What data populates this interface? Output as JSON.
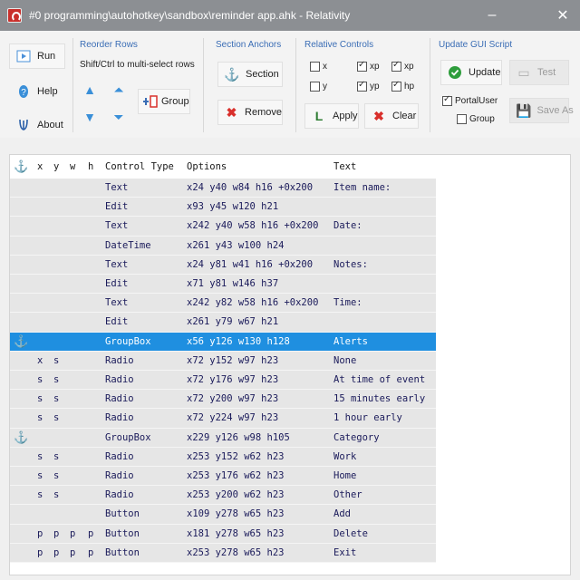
{
  "window": {
    "title": "#0 programming\\autohotkey\\sandbox\\reminder app.ahk - Relativity",
    "minimize": "–",
    "maximize": "□",
    "close": "✕"
  },
  "toolbar": {
    "run_label": "Run",
    "help_label": "Help",
    "about_label": "About",
    "reorder_rows": {
      "title": "Reorder Rows",
      "hint": "Shift/Ctrl to multi-select rows",
      "group_label": "Group"
    },
    "section_anchors": {
      "title": "Section Anchors",
      "section_label": "Section",
      "remove_label": "Remove"
    },
    "relative_controls": {
      "title": "Relative Controls",
      "checkboxes": [
        {
          "label": "x",
          "checked": false
        },
        {
          "label": "xp",
          "checked": true
        },
        {
          "label": "xp",
          "checked": true
        },
        {
          "label": "y",
          "checked": false
        },
        {
          "label": "yp",
          "checked": true
        },
        {
          "label": "hp",
          "checked": true
        }
      ],
      "apply_label": "Apply",
      "clear_label": "Clear"
    },
    "update_script": {
      "title": "Update GUI Script",
      "update_label": "Update",
      "test_label": "Test",
      "save_as_label": "Save As",
      "portal_label": "PortalUser",
      "group_label": "Group"
    }
  },
  "grid": {
    "headers": [
      "x",
      "y",
      "w",
      "h",
      "Control Type",
      "Options",
      "Text"
    ],
    "rows": [
      {
        "anchor": false,
        "x": "",
        "y": "",
        "w": "",
        "h": "",
        "type": "Text",
        "options": "x24 y40 w84 h16 +0x200",
        "text": "Item name:"
      },
      {
        "anchor": false,
        "x": "",
        "y": "",
        "w": "",
        "h": "",
        "type": "Edit",
        "options": "x93 y45 w120 h21",
        "text": ""
      },
      {
        "anchor": false,
        "x": "",
        "y": "",
        "w": "",
        "h": "",
        "type": "Text",
        "options": "x242 y40 w58 h16 +0x200",
        "text": "Date:"
      },
      {
        "anchor": false,
        "x": "",
        "y": "",
        "w": "",
        "h": "",
        "type": "DateTime",
        "options": "x261 y43 w100 h24",
        "text": ""
      },
      {
        "anchor": false,
        "x": "",
        "y": "",
        "w": "",
        "h": "",
        "type": "Text",
        "options": "x24 y81 w41 h16 +0x200",
        "text": "Notes:"
      },
      {
        "anchor": false,
        "x": "",
        "y": "",
        "w": "",
        "h": "",
        "type": "Edit",
        "options": "x71 y81 w146 h37",
        "text": ""
      },
      {
        "anchor": false,
        "x": "",
        "y": "",
        "w": "",
        "h": "",
        "type": "Text",
        "options": "x242 y82 w58 h16 +0x200",
        "text": "Time:"
      },
      {
        "anchor": false,
        "x": "",
        "y": "",
        "w": "",
        "h": "",
        "type": "Edit",
        "options": "x261 y79 w67 h21",
        "text": ""
      },
      {
        "anchor": true,
        "x": "",
        "y": "",
        "w": "",
        "h": "",
        "type": "GroupBox",
        "options": "x56 y126 w130 h128",
        "text": "Alerts",
        "selected": true
      },
      {
        "anchor": false,
        "x": "x",
        "y": "s",
        "w": "",
        "h": "",
        "type": "Radio",
        "options": "x72 y152 w97 h23",
        "text": "None"
      },
      {
        "anchor": false,
        "x": "s",
        "y": "s",
        "w": "",
        "h": "",
        "type": "Radio",
        "options": "x72 y176 w97 h23",
        "text": "At time of event"
      },
      {
        "anchor": false,
        "x": "s",
        "y": "s",
        "w": "",
        "h": "",
        "type": "Radio",
        "options": "x72 y200 w97 h23",
        "text": "15 minutes early"
      },
      {
        "anchor": false,
        "x": "s",
        "y": "s",
        "w": "",
        "h": "",
        "type": "Radio",
        "options": "x72 y224 w97 h23",
        "text": "1 hour early"
      },
      {
        "anchor": true,
        "x": "",
        "y": "",
        "w": "",
        "h": "",
        "type": "GroupBox",
        "options": "x229 y126 w98 h105",
        "text": "Category"
      },
      {
        "anchor": false,
        "x": "s",
        "y": "s",
        "w": "",
        "h": "",
        "type": "Radio",
        "options": "x253 y152 w62 h23",
        "text": "Work"
      },
      {
        "anchor": false,
        "x": "s",
        "y": "s",
        "w": "",
        "h": "",
        "type": "Radio",
        "options": "x253 y176 w62 h23",
        "text": "Home"
      },
      {
        "anchor": false,
        "x": "s",
        "y": "s",
        "w": "",
        "h": "",
        "type": "Radio",
        "options": "x253 y200 w62 h23",
        "text": "Other"
      },
      {
        "anchor": false,
        "x": "",
        "y": "",
        "w": "",
        "h": "",
        "type": "Button",
        "options": "x109 y278 w65 h23",
        "text": "Add"
      },
      {
        "anchor": false,
        "x": "p",
        "y": "p",
        "w": "p",
        "h": "p",
        "type": "Button",
        "options": "x181 y278 w65 h23",
        "text": "Delete"
      },
      {
        "anchor": false,
        "x": "p",
        "y": "p",
        "w": "p",
        "h": "p",
        "type": "Button",
        "options": "x253 y278 w65 h23",
        "text": "Exit"
      }
    ]
  },
  "colors": {
    "selection": "#1f8fe0",
    "row_bg": "#e6e6e6",
    "accent_blue": "#3a6db5",
    "remove_red": "#d9302c",
    "update_green": "#2e9d3c"
  }
}
